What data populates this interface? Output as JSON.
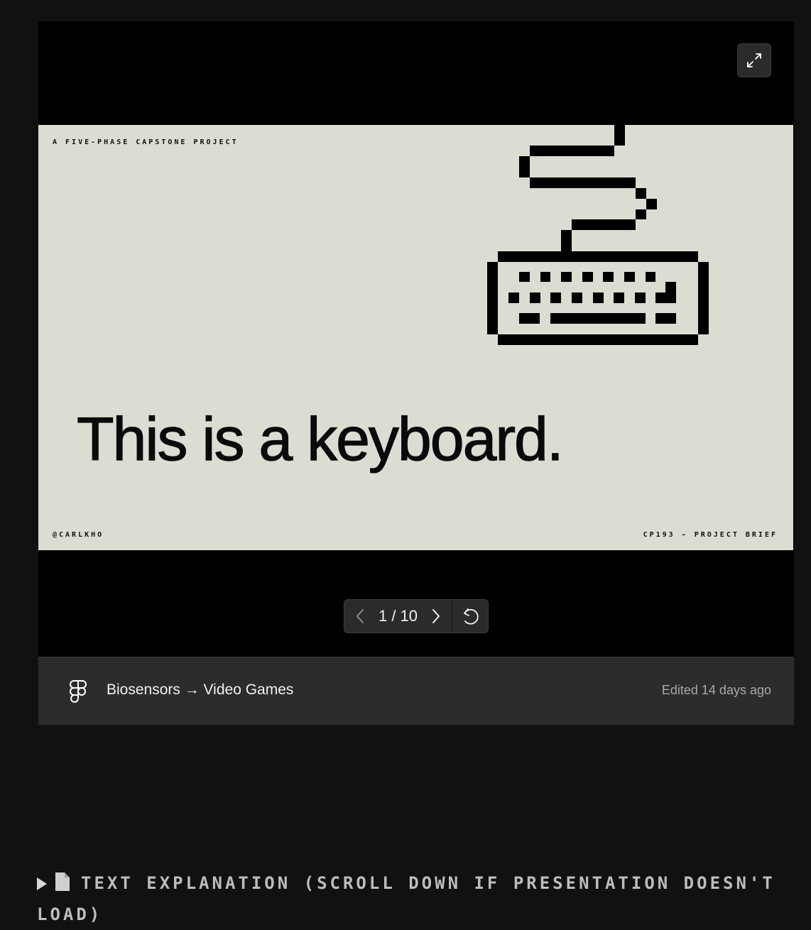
{
  "embed": {
    "fullscreen_icon": "expand-arrows-icon",
    "slide": {
      "top_label": "A FIVE-PHASE CAPSTONE PROJECT",
      "headline": "This is a keyboard.",
      "handle": "@CARLKHO",
      "course": "CP193 - PROJECT BRIEF",
      "illustration": "pixel-keyboard-icon"
    },
    "pager": {
      "current": "1",
      "total": "10",
      "display": "1 / 10",
      "prev_icon": "chevron-left-icon",
      "next_icon": "chevron-right-icon",
      "restart_icon": "restart-icon"
    },
    "footer": {
      "logo_icon": "figma-icon",
      "title": "Biosensors → Video Games",
      "edited": "Edited 14 days ago"
    }
  },
  "toggle": {
    "icon": "triangle-right-icon",
    "doc_icon": "page-icon",
    "label": "TEXT EXPLANATION (SCROLL DOWN IF PRESENTATION DOESN'T LOAD)"
  },
  "colors": {
    "page_bg": "#111111",
    "embed_bg": "#000000",
    "slide_bg": "#dcdcd2",
    "footer_bg": "#2c2c2c",
    "toggle_text": "#bdbdbd"
  }
}
